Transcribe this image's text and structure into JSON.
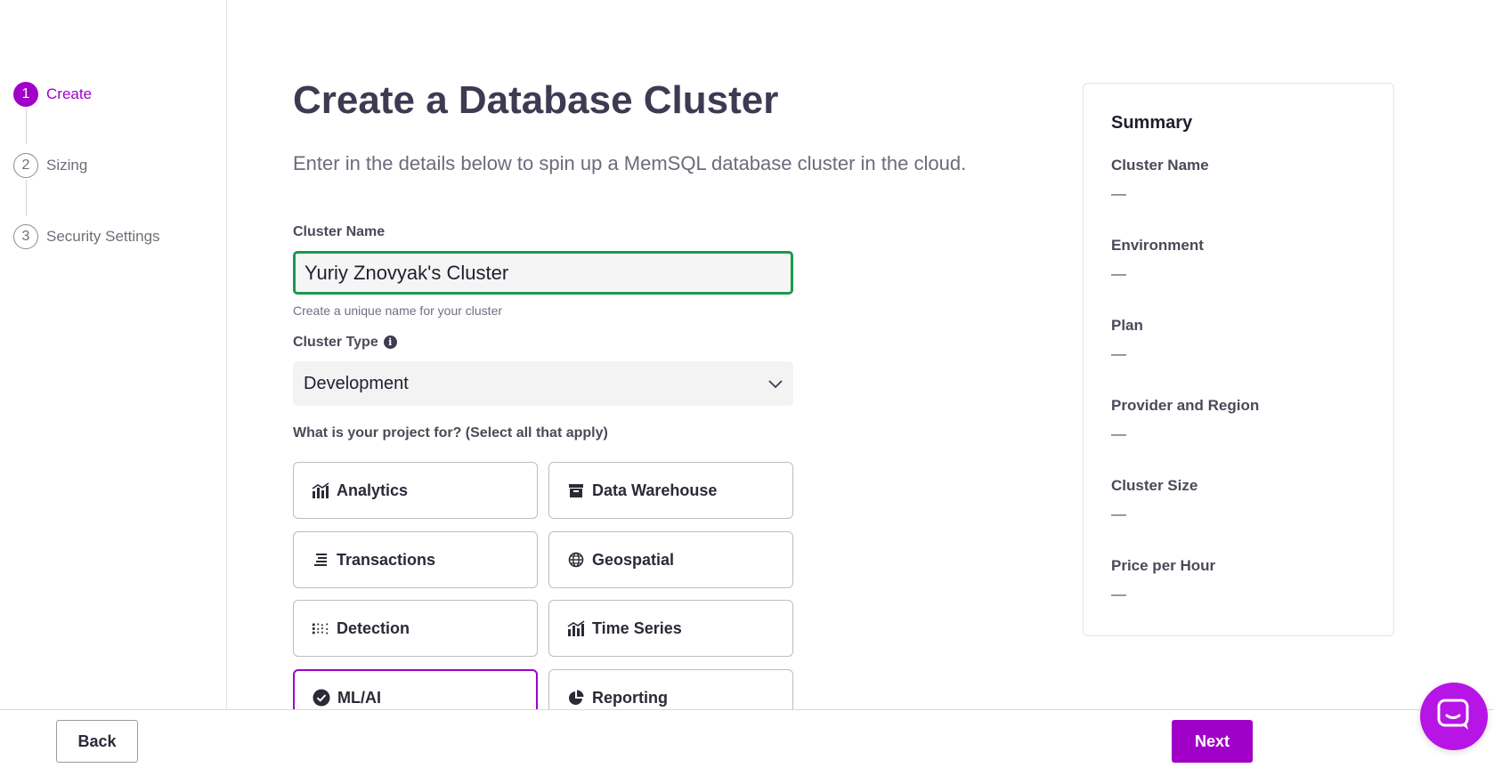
{
  "steps": [
    {
      "number": "1",
      "label": "Create",
      "active": true
    },
    {
      "number": "2",
      "label": "Sizing",
      "active": false
    },
    {
      "number": "3",
      "label": "Security Settings",
      "active": false
    }
  ],
  "main": {
    "title": "Create a Database Cluster",
    "subtitle": "Enter in the details below to spin up a MemSQL database cluster in the cloud.",
    "cluster_name": {
      "label": "Cluster Name",
      "value": "Yuriy Znovyak's Cluster",
      "help": "Create a unique name for your cluster"
    },
    "cluster_type": {
      "label": "Cluster Type",
      "info_icon": "i",
      "selected": "Development"
    },
    "project_question": "What is your project for? (Select all that apply)",
    "options": [
      {
        "label": "Analytics",
        "icon": "bar-chart-icon",
        "selected": false
      },
      {
        "label": "Data Warehouse",
        "icon": "archive-box-icon",
        "selected": false
      },
      {
        "label": "Transactions",
        "icon": "stacked-list-icon",
        "selected": false
      },
      {
        "label": "Geospatial",
        "icon": "globe-icon",
        "selected": false
      },
      {
        "label": "Detection",
        "icon": "dot-grid-icon",
        "selected": false
      },
      {
        "label": "Time Series",
        "icon": "bar-line-chart-icon",
        "selected": false
      },
      {
        "label": "ML/AI",
        "icon": "check-circle-icon",
        "selected": true
      },
      {
        "label": "Reporting",
        "icon": "pie-chart-icon",
        "selected": false
      }
    ]
  },
  "summary": {
    "title": "Summary",
    "items": [
      {
        "label": "Cluster Name",
        "value": "—"
      },
      {
        "label": "Environment",
        "value": "—"
      },
      {
        "label": "Plan",
        "value": "—"
      },
      {
        "label": "Provider and Region",
        "value": "—"
      },
      {
        "label": "Cluster Size",
        "value": "—"
      },
      {
        "label": "Price per Hour",
        "value": "—"
      }
    ]
  },
  "footer": {
    "back_label": "Back",
    "next_label": "Next"
  },
  "chat": {
    "icon": "chat-icon"
  },
  "colors": {
    "accent": "#a100c8",
    "input_focus_border": "#1a9a4a",
    "title_text": "#3e3a52"
  }
}
